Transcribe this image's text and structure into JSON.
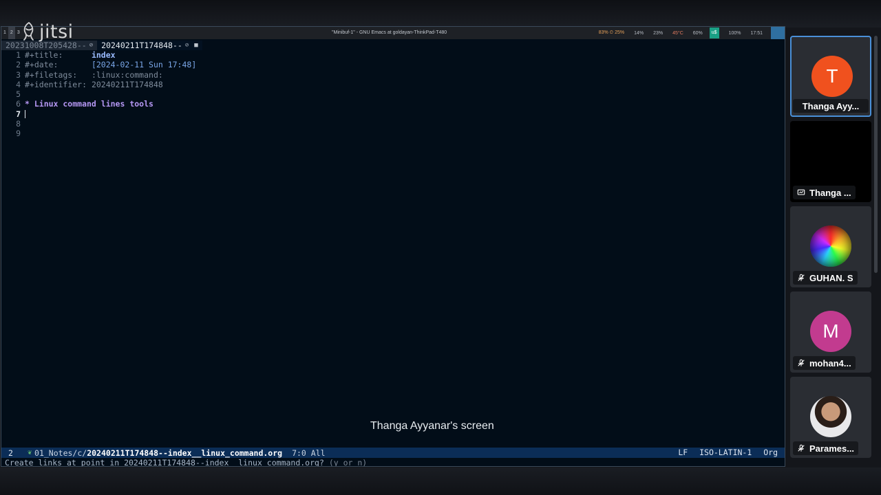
{
  "app": {
    "watermark": "jitsi"
  },
  "topbar": {
    "workspaces": [
      "1",
      "2",
      "3"
    ],
    "window_title": "\"Minibuf-1\" - GNU Emacs at goldayan-ThinkPad-T480",
    "cpu": "83% ⏲ 25%",
    "mem": "14%",
    "disk": "23%",
    "temp": "45°C",
    "brightness": "60%",
    "badge": "u$",
    "battery": "100%",
    "clock": "17:51"
  },
  "emacs": {
    "tabs": [
      {
        "label": "20231008T205428--",
        "current": false
      },
      {
        "label": "20240211T174848--",
        "current": true
      }
    ],
    "lines": {
      "l1_num": "1",
      "l1_key": "#+title:      ",
      "l1_val": "index",
      "l2_num": "2",
      "l2_key": "#+date:       ",
      "l2_val": "[2024-02-11 Sun 17:48]",
      "l3_num": "3",
      "l3_key": "#+filetags:   ",
      "l3_val": ":linux:command:",
      "l4_num": "4",
      "l4_key": "#+identifier: ",
      "l4_val": "20240211T174848",
      "l5_num": "5",
      "l6_num": "6",
      "l6_heading": "* Linux command lines tools",
      "l7_num": "7",
      "l8_num": "8",
      "l9_num": "9"
    },
    "modeline": {
      "window_num": "2",
      "path_dir": "01_Notes/c/",
      "path_file": "20240211T174848--index__linux_command.org",
      "position": "7:0 All",
      "eol": "LF",
      "encoding": "ISO-LATIN-1",
      "mode": "Org"
    },
    "minibuffer": {
      "prompt": "Create links at point in 20240211T174848--index__linux_command.org? ",
      "hint": "(y or n) "
    }
  },
  "screen_caption": "Thanga Ayyanar's screen",
  "participants": [
    {
      "name": "Thanga Ayy...",
      "initial": "T",
      "color": "#f0511e"
    },
    {
      "name": "Thanga ..."
    },
    {
      "name": "GUHAN. S"
    },
    {
      "name": "mohan4...",
      "initial": "M",
      "color": "#c23b8f"
    },
    {
      "name": "Parames..."
    }
  ]
}
